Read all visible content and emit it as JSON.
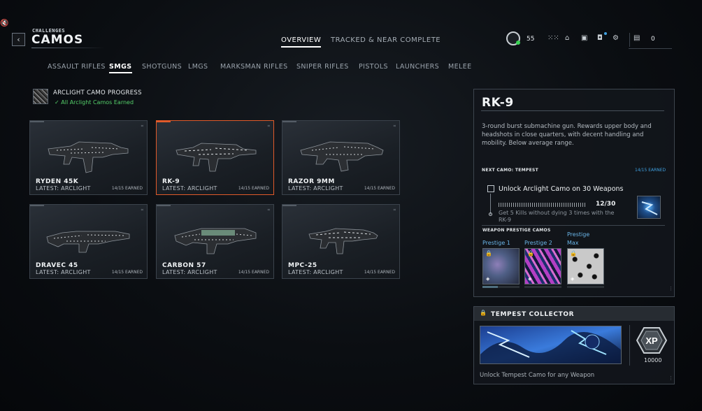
{
  "header": {
    "breadcrumb": "CHALLENGES",
    "title": "CAMOS",
    "tabs": [
      {
        "label": "OVERVIEW",
        "active": true
      },
      {
        "label": "TRACKED & NEAR COMPLETE",
        "active": false
      }
    ],
    "player_level": "55",
    "currency_count": "0"
  },
  "categories": [
    {
      "label": "ASSAULT RIFLES",
      "active": false
    },
    {
      "label": "SMGS",
      "active": true
    },
    {
      "label": "SHOTGUNS",
      "active": false
    },
    {
      "label": "LMGS",
      "active": false
    },
    {
      "label": "MARKSMAN RIFLES",
      "active": false
    },
    {
      "label": "SNIPER RIFLES",
      "active": false
    },
    {
      "label": "PISTOLS",
      "active": false
    },
    {
      "label": "LAUNCHERS",
      "active": false
    },
    {
      "label": "MELEE",
      "active": false
    }
  ],
  "progress": {
    "title": "ARCLIGHT CAMO PROGRESS",
    "status": "All Arclight Camos Earned"
  },
  "weapons": [
    {
      "name": "RYDEN 45K",
      "latest": "LATEST: ARCLIGHT",
      "earned": "14/15 EARNED",
      "selected": false
    },
    {
      "name": "RK-9",
      "latest": "LATEST: ARCLIGHT",
      "earned": "14/15 EARNED",
      "selected": true
    },
    {
      "name": "RAZOR 9MM",
      "latest": "LATEST: ARCLIGHT",
      "earned": "14/15 EARNED",
      "selected": false
    },
    {
      "name": "DRAVEC 45",
      "latest": "LATEST: ARCLIGHT",
      "earned": "14/15 EARNED",
      "selected": false
    },
    {
      "name": "CARBON 57",
      "latest": "LATEST: ARCLIGHT",
      "earned": "14/15 EARNED",
      "selected": false
    },
    {
      "name": "MPC-25",
      "latest": "LATEST: ARCLIGHT",
      "earned": "14/15 EARNED",
      "selected": false
    }
  ],
  "detail": {
    "name": "RK-9",
    "description": "3-round burst submachine gun. Rewards upper body and headshots in close quarters, with decent handling and mobility. Below average range.",
    "next_camo_label": "NEXT CAMO: TEMPEST",
    "next_camo_earned": "14/15 EARNED",
    "challenge_title": "Unlock Arclight Camo on 30 Weapons",
    "challenge_count": "12/30",
    "challenge_sub": "Get 5 Kills without dying 3 times with the RK-9",
    "prestige_label": "WEAPON PRESTIGE CAMOS",
    "prestige": [
      {
        "label": "Prestige 1"
      },
      {
        "label": "Prestige 2"
      },
      {
        "label": "Prestige Max"
      }
    ]
  },
  "collector": {
    "title": "TEMPEST COLLECTOR",
    "reward": "10000",
    "xp_label": "XP",
    "description": "Unlock Tempest Camo for any Weapon"
  },
  "icons": {
    "back": "chevron-left-icon",
    "mute": "speaker-mute-icon",
    "lock": "lock-icon"
  },
  "colors": {
    "accent_selected": "#e05a2a",
    "earned_green": "#55d06a",
    "info_blue": "#3fa0e0"
  }
}
